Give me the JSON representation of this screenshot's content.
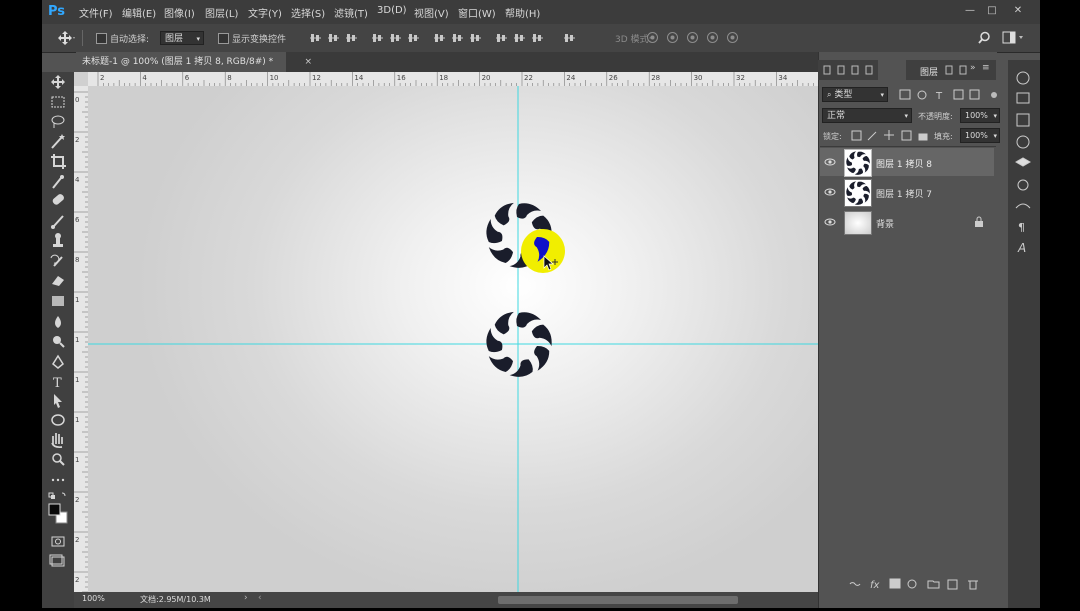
{
  "app": {
    "logo": "Ps"
  },
  "menu": [
    "文件(F)",
    "编辑(E)",
    "图像(I)",
    "图层(L)",
    "文字(Y)",
    "选择(S)",
    "滤镜(T)",
    "3D(D)",
    "视图(V)",
    "窗口(W)",
    "帮助(H)"
  ],
  "window_controls": {
    "minimize": "—",
    "maximize": "□",
    "close": "✕"
  },
  "options": {
    "auto_select_label": "自动选择:",
    "auto_select_target": "图层",
    "show_transform_label": "显示变换控件",
    "mode_3d_label": "3D 模式:"
  },
  "document": {
    "tab_title": "未标题-1 @ 100% (图层 1 拷贝 8, RGB/8#) *",
    "tab_close": "×",
    "ruler_h_labels": [
      "2",
      "4",
      "6",
      "8",
      "10",
      "12",
      "14",
      "16",
      "18",
      "20",
      "22",
      "24",
      "26",
      "28",
      "30",
      "32",
      "34"
    ],
    "ruler_v_labels": [
      "0",
      "2",
      "4",
      "6",
      "8",
      "1",
      "1",
      "1",
      "1",
      "1",
      "2",
      "2",
      "2"
    ]
  },
  "status": {
    "zoom": "100%",
    "doc_size": "文档:2.95M/10.3M"
  },
  "layers_panel": {
    "active_tab": "图层",
    "filter_kind": "类型",
    "blend_mode": "正常",
    "opacity_label": "不透明度:",
    "opacity_value": "100%",
    "lock_label": "锁定:",
    "fill_label": "填充:",
    "fill_value": "100%",
    "layers": [
      {
        "name": "图层 1 拷贝 8",
        "selected": true
      },
      {
        "name": "图层 1 拷贝 7",
        "selected": false
      },
      {
        "name": "背景",
        "selected": false,
        "locked": true
      }
    ]
  },
  "colors": {
    "accent_guide": "#3fd8e0",
    "shape": "#1a1d2b",
    "highlight": "#f1ee00",
    "selection_shape": "#1010c8"
  }
}
